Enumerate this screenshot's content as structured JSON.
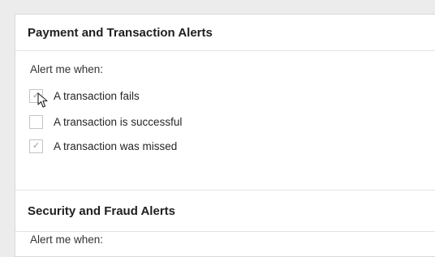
{
  "sections": [
    {
      "title": "Payment and Transaction Alerts",
      "prompt": "Alert me when:",
      "options": [
        {
          "label": "A transaction fails",
          "checked": true
        },
        {
          "label": "A transaction is successful",
          "checked": false
        },
        {
          "label": "A transaction was missed",
          "checked": true
        }
      ]
    },
    {
      "title": "Security and Fraud Alerts",
      "prompt": "Alert me when:"
    }
  ],
  "icons": {
    "checkmark": "check-icon",
    "cursor": "mouse-cursor-icon"
  },
  "colors": {
    "background": "#ececec",
    "panel": "#ffffff",
    "border": "#d9d9d9",
    "check": "#9a9a9a"
  }
}
